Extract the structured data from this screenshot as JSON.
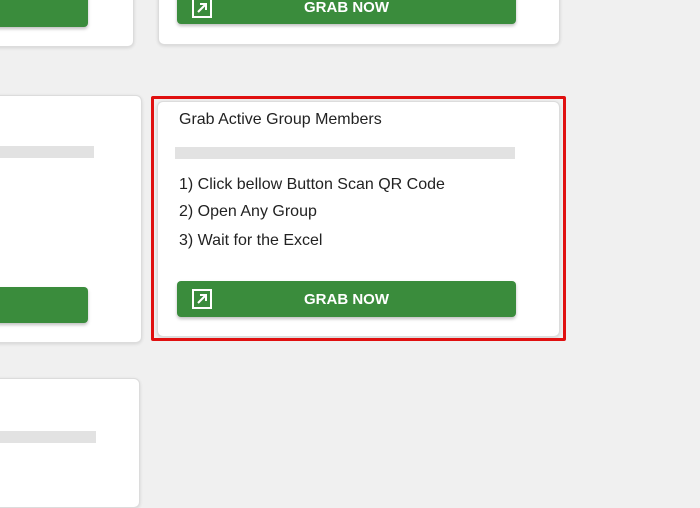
{
  "cards": {
    "top_left": {},
    "top_right": {
      "button_label": "GRAB NOW",
      "button_icon": "external-link-icon"
    },
    "mid_left": {},
    "main": {
      "title": "Grab Active Group Members",
      "steps": [
        "1) Click bellow Button Scan QR Code",
        "2) Open Any Group",
        "3) Wait for the Excel"
      ],
      "button_label": "GRAB NOW",
      "button_icon": "external-link-icon"
    },
    "bottom_left": {}
  },
  "colors": {
    "button_green": "#3a8c3c",
    "highlight_red": "#e01010",
    "page_background": "#f0f0f0",
    "placeholder_bar": "#e2e2e2"
  }
}
